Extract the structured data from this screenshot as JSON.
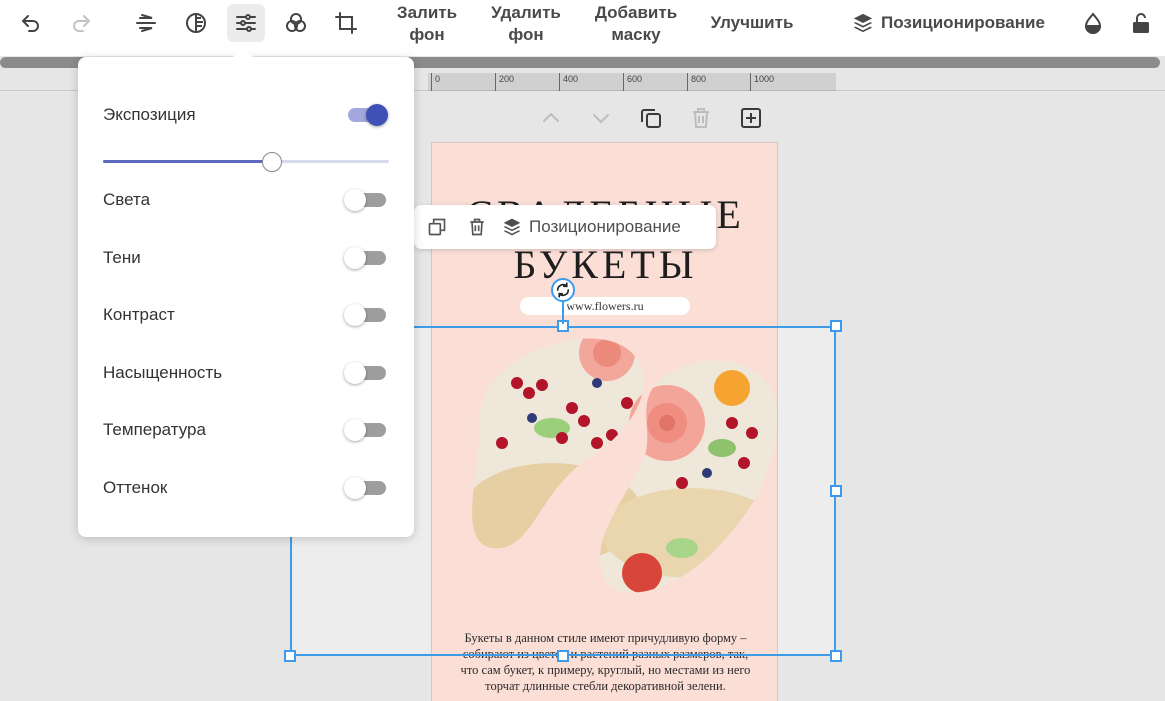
{
  "toolbar": {
    "icons": [
      "undo-icon",
      "redo-icon",
      "flip-icon",
      "filter-icon",
      "adjust-icon",
      "blend-icon",
      "crop-icon",
      "fill-drop-icon",
      "lock-open-icon"
    ],
    "fill_bg_line1": "Залить",
    "fill_bg_line2": "фон",
    "remove_bg_line1": "Удалить",
    "remove_bg_line2": "фон",
    "add_mask_line1": "Добавить",
    "add_mask_line2": "маску",
    "enhance": "Улучшить",
    "positioning": "Позиционирование"
  },
  "ruler": {
    "ticks": [
      "0",
      "200",
      "400",
      "600",
      "800",
      "1000"
    ]
  },
  "adjust_panel": {
    "exposure": {
      "label": "Экспозиция",
      "enabled": true,
      "value": 0.59
    },
    "items": [
      {
        "label": "Света",
        "enabled": false
      },
      {
        "label": "Тени",
        "enabled": false
      },
      {
        "label": "Контраст",
        "enabled": false
      },
      {
        "label": "Насыщенность",
        "enabled": false
      },
      {
        "label": "Температура",
        "enabled": false
      },
      {
        "label": "Оттенок",
        "enabled": false
      }
    ],
    "accent": "#3f51b5"
  },
  "context_toolbar": {
    "positioning": "Позиционирование"
  },
  "design": {
    "title_line1": "СВАДЕБНЫЕ",
    "title_line2": "БУКЕТЫ",
    "url": "www.flowers.ru",
    "caption": "Букеты в данном стиле имеют причудливую форму – собирают из цветов и растений разных размеров, так, что сам букет, к примеру, круглый, но местами из него торчат длинные стебли декоративной зелени.",
    "background": "#fbdfd7"
  },
  "selection": {
    "color": "#3d9be9"
  }
}
